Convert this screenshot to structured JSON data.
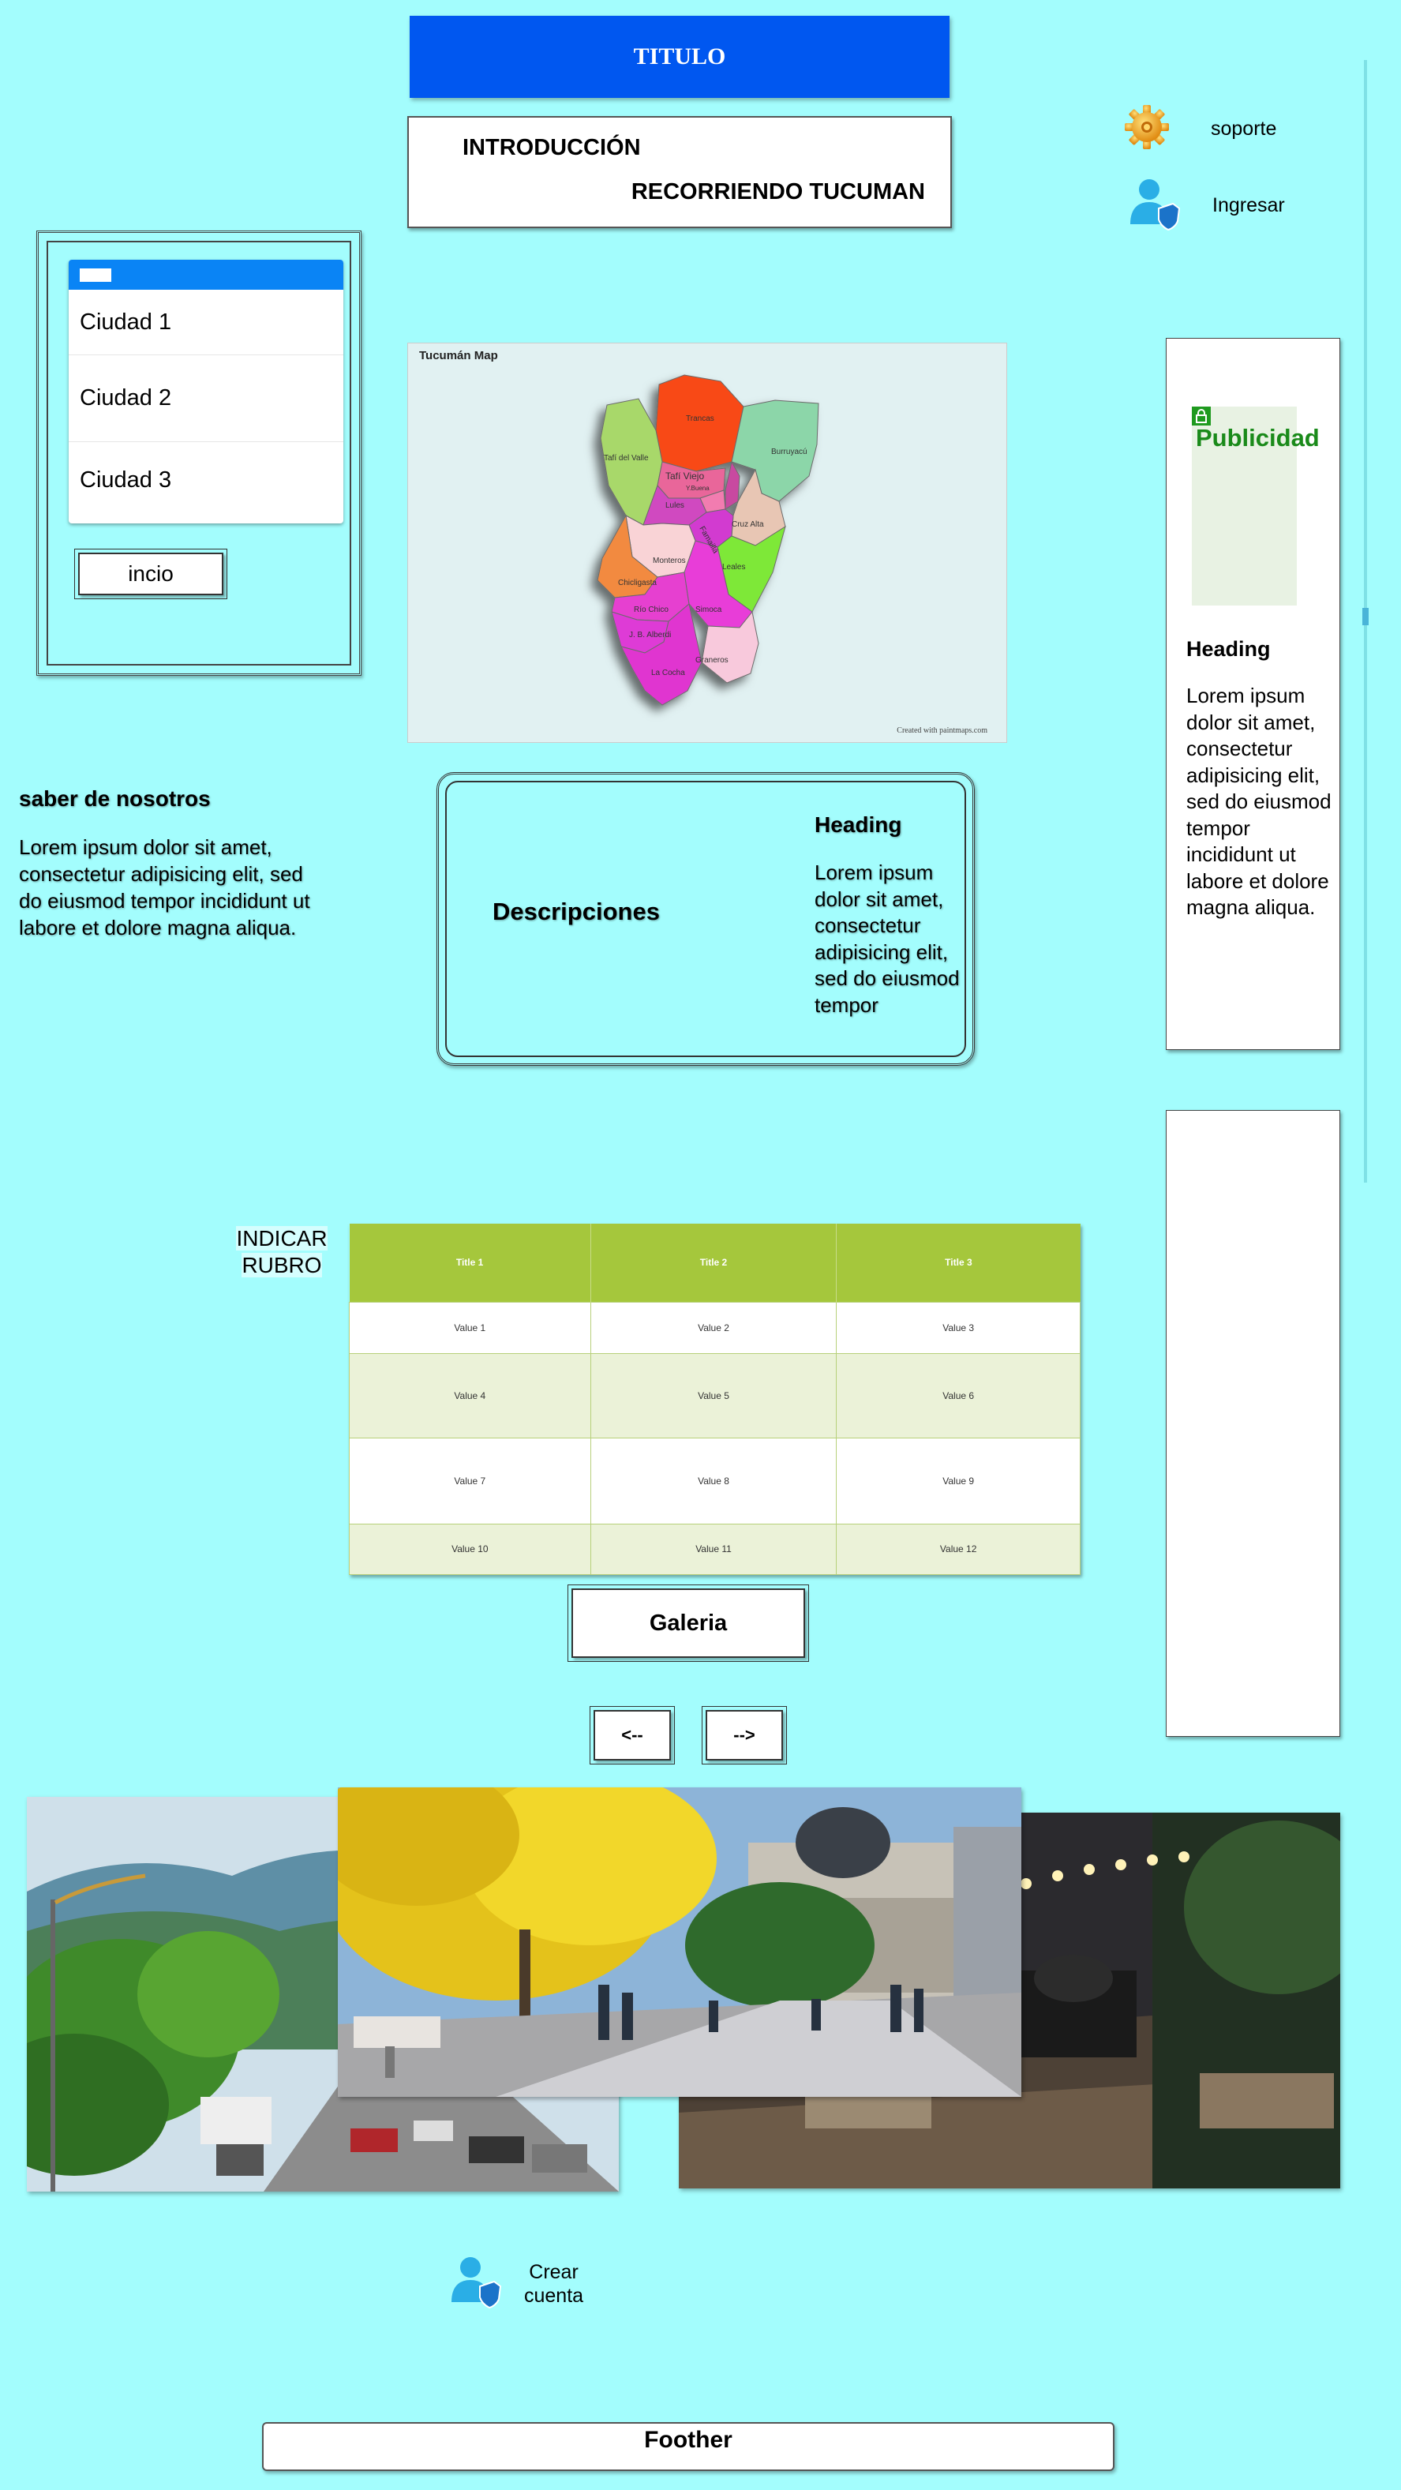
{
  "header": {
    "title": "TITULO",
    "intro": "INTRODUCCIÓN",
    "subtitle": "RECORRIENDO TUCUMAN"
  },
  "top_links": {
    "support_label": "soporte",
    "support_icon": "gear-icon",
    "login_label": "Ingresar",
    "login_icon": "user-shield-icon"
  },
  "cities": {
    "items": [
      "Ciudad 1",
      "Ciudad 2",
      "Ciudad 3"
    ],
    "home_button": "incio"
  },
  "map": {
    "title": "Tucumán Map",
    "credit": "Created with paintmaps.com",
    "regions": [
      "Trancas",
      "Burruyacú",
      "Tafí del Valle",
      "Tafí Viejo",
      "Yerba Buena",
      "Lules",
      "Capital",
      "Cruz Alta",
      "Famaillá",
      "Monteros",
      "Leales",
      "Chicligasta",
      "Río Chico",
      "Simoca",
      "J. B. Alberdi",
      "Graneros",
      "La Cocha"
    ]
  },
  "ad": {
    "label": "Publicidad",
    "heading": "Heading",
    "body": "Lorem ipsum dolor sit amet, consectetur adipisicing elit, sed do eiusmod tempor incididunt ut labore et dolore magna aliqua."
  },
  "about": {
    "title": "saber de nosotros",
    "body": "Lorem ipsum dolor sit amet, consectetur adipisicing elit, sed do eiusmod tempor incididunt ut labore et dolore magna aliqua."
  },
  "descriptions": {
    "label": "Descripciones",
    "heading": "Heading",
    "body": "Lorem ipsum dolor sit amet, consectetur adipisicing elit, sed do eiusmod tempor"
  },
  "rubro": {
    "line1": "INDICAR",
    "line2": "RUBRO"
  },
  "table": {
    "headers": [
      "Title 1",
      "Title 2",
      "Title 3"
    ],
    "rows": [
      [
        "Value 1",
        "Value 2",
        "Value 3"
      ],
      [
        "Value 4",
        "Value 5",
        "Value 6"
      ],
      [
        "Value 7",
        "Value 8",
        "Value 9"
      ],
      [
        "Value 10",
        "Value 11",
        "Value 12"
      ]
    ]
  },
  "gallery": {
    "title": "Galeria",
    "prev_label": "<--",
    "next_label": "-->"
  },
  "signup": {
    "line1": "Crear",
    "line2": "cuenta",
    "icon": "user-shield-icon"
  },
  "footer": {
    "label": "Foother"
  },
  "colors": {
    "background": "#a3fdfd",
    "title_bar": "#0057f0",
    "table_header": "#a5c73c",
    "ad_label": "#1a8a1a",
    "list_header": "#0a84f5"
  }
}
